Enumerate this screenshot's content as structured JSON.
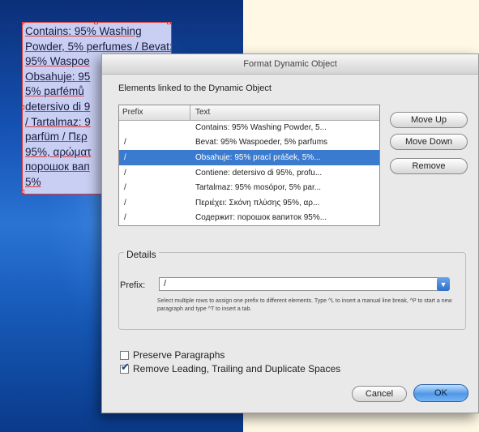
{
  "background_frame": {
    "lines": [
      "Contains: 95% Washing",
      "Powder, 5% perfumes / Bevat:",
      "95% Waspoe",
      "Obsahuje: 95",
      "5% parfémů",
      "detersivo di 9",
      "/ Tartalmaz: 9",
      "parfüm / Περ",
      "95%, αρώματ",
      "порошок вап",
      "5%"
    ]
  },
  "dialog": {
    "title": "Format Dynamic Object",
    "elements_label": "Elements linked to the Dynamic Object",
    "columns": {
      "prefix": "Prefix",
      "text": "Text"
    },
    "rows": [
      {
        "prefix": "",
        "text": "Contains: 95% Washing Powder, 5...",
        "selected": false
      },
      {
        "prefix": "/",
        "text": "Bevat: 95% Waspoeder, 5% parfums",
        "selected": false
      },
      {
        "prefix": "/",
        "text": "Obsahuje: 95% prací prášek, 5%...",
        "selected": true
      },
      {
        "prefix": "/",
        "text": "Contiene: detersivo di 95%, profu...",
        "selected": false
      },
      {
        "prefix": "/",
        "text": "Tartalmaz: 95% mosópor, 5% par...",
        "selected": false
      },
      {
        "prefix": "/",
        "text": "Περιέχει: Σκόνη πλύσης 95%, αρ...",
        "selected": false
      },
      {
        "prefix": "/",
        "text": "Содержит: порошок вапиток 95%...",
        "selected": false
      }
    ],
    "buttons": {
      "move_up": "Move Up",
      "move_down": "Move Down",
      "remove": "Remove"
    },
    "details": {
      "title": "Details",
      "prefix_label": "Prefix:",
      "prefix_value": "/",
      "help_text": "Select multiple rows to assign one prefix to different elements. Type ^L to insert a manual line break, ^P to start a new paragraph and type ^T to insert a tab."
    },
    "options": {
      "preserve_paragraphs": {
        "label": "Preserve Paragraphs",
        "checked": false
      },
      "remove_spaces": {
        "label": "Remove Leading, Trailing and Duplicate Spaces",
        "checked": true
      }
    },
    "cancel_label": "Cancel",
    "ok_label": "OK"
  },
  "colors": {
    "selection": "#3a7bd0",
    "frame_border": "#e0342c",
    "frame_fill": "#c8cff2",
    "ok_button": "#4f97e6"
  },
  "icons": {
    "dropdown": "chevron-down-icon",
    "checkmark": "checkmark-icon"
  }
}
